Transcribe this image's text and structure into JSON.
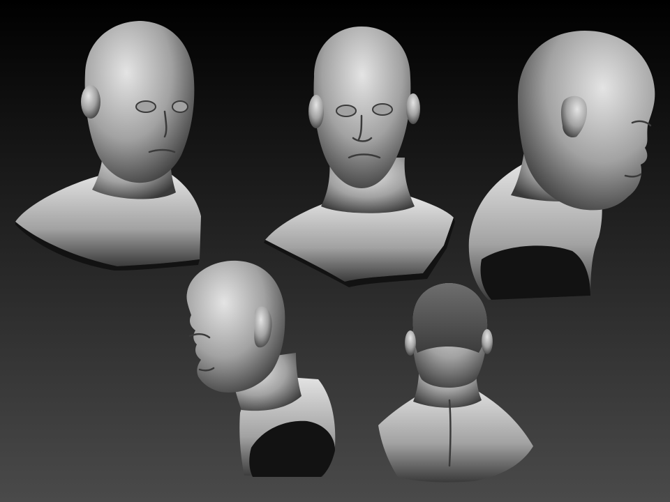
{
  "scene": {
    "background": {
      "top_color": "#000000",
      "bottom_color": "#4a4a4a"
    },
    "material": {
      "highlight": "#e4e4e4",
      "mid": "#a2a2a2",
      "shadow": "#3a3a3a",
      "cut_face": "#121212"
    },
    "busts": [
      {
        "view": "three-quarter-front-left"
      },
      {
        "view": "front"
      },
      {
        "view": "profile-right"
      },
      {
        "view": "profile-left-low"
      },
      {
        "view": "back"
      }
    ]
  }
}
